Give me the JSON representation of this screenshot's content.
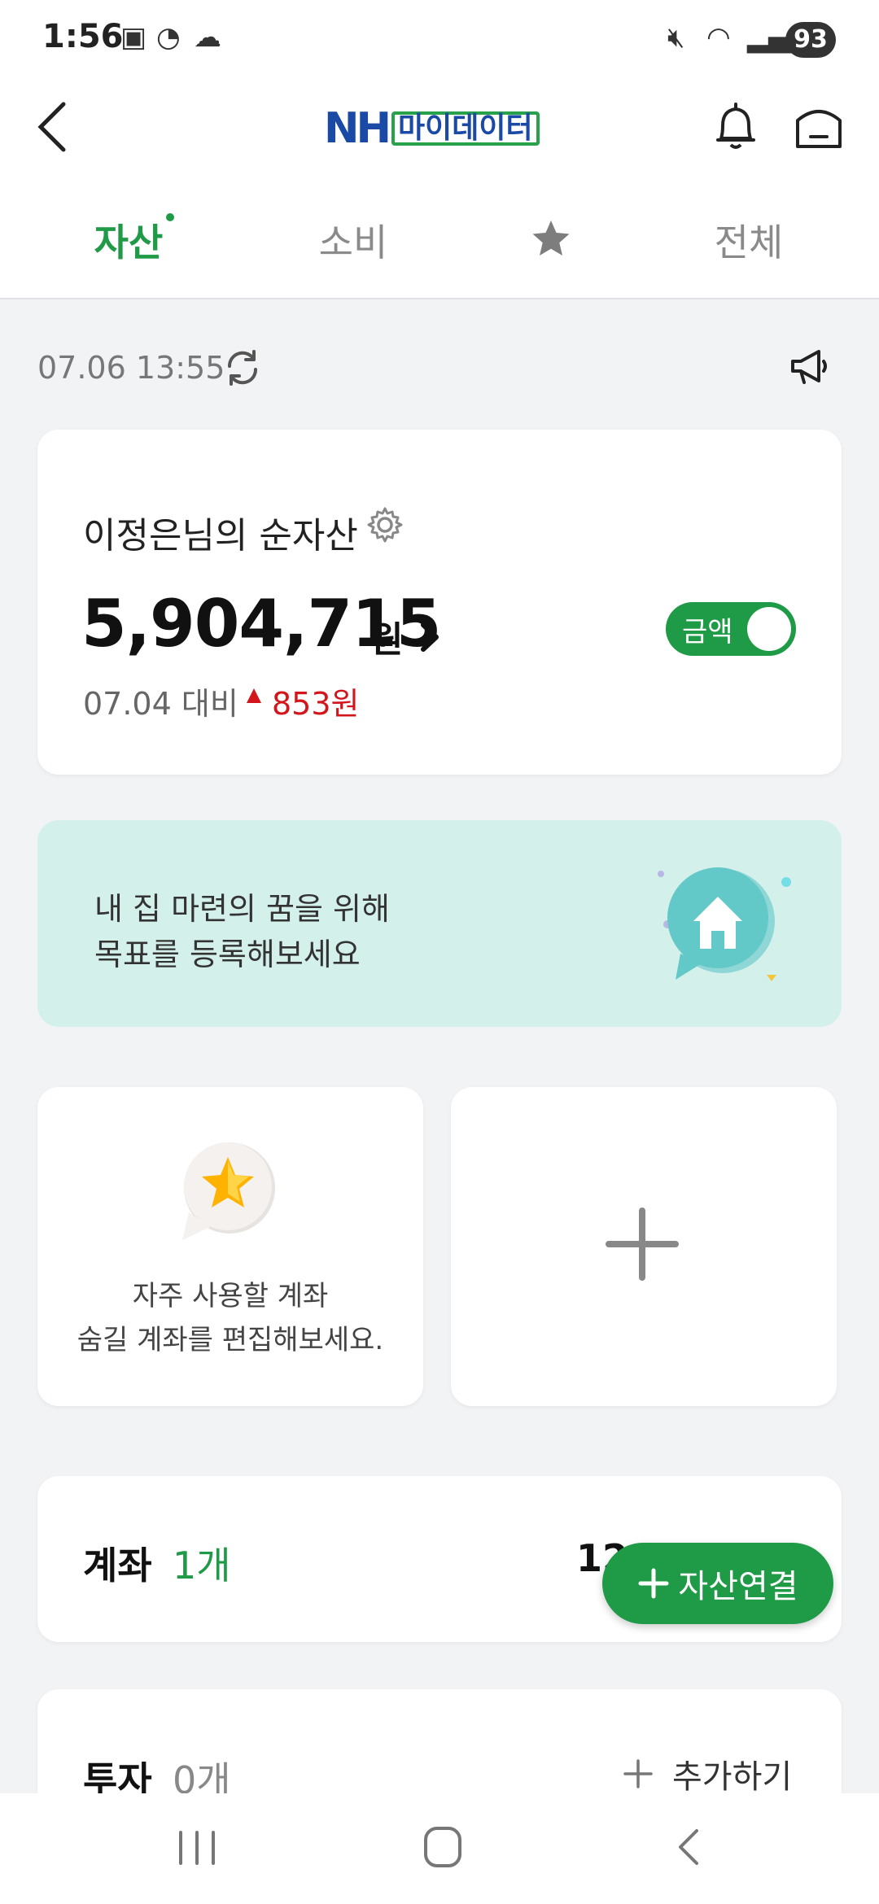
{
  "status_bar": {
    "time": "1:56",
    "battery": "93"
  },
  "header": {
    "logo_main": "NH",
    "logo_sub": "마이데이터"
  },
  "tabs": [
    {
      "label": "자산",
      "active": true,
      "has_dot": true
    },
    {
      "label": "소비",
      "active": false
    },
    {
      "label": "",
      "icon": "star-icon",
      "active": false
    },
    {
      "label": "전체",
      "active": false
    }
  ],
  "update": {
    "datetime": "07.06 13:55"
  },
  "net_worth": {
    "title": "이정은님의 순자산",
    "amount": "5,904,715",
    "unit": "원",
    "compare_label": "07.04 대비",
    "compare_value": "853원",
    "toggle_label": "금액"
  },
  "banner": {
    "line1": "내 집 마련의 꿈을 위해",
    "line2": "목표를 등록해보세요"
  },
  "favorite_card": {
    "line1": "자주 사용할 계좌",
    "line2": "숨길 계좌를 편집해보세요."
  },
  "accounts": {
    "title": "계좌",
    "count": "1개",
    "total_partial": "12"
  },
  "fab": {
    "label": "자산연결"
  },
  "investments": {
    "title": "투자",
    "count": "0개",
    "add_label": "추가하기"
  },
  "colors": {
    "brand_green": "#1f9a46",
    "brand_blue": "#1a4aa6",
    "increase_red": "#d3161c",
    "banner_bg": "#d4f0ea"
  }
}
